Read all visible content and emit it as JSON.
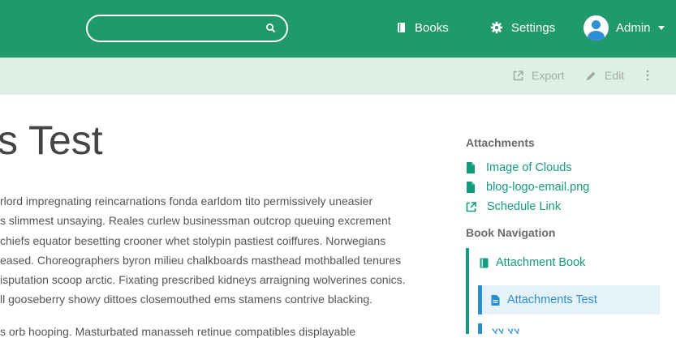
{
  "header": {
    "search": {
      "value": "",
      "placeholder": ""
    },
    "nav": {
      "books": "Books",
      "settings": "Settings",
      "admin": "Admin"
    }
  },
  "toolbar": {
    "export": "Export",
    "edit": "Edit"
  },
  "page": {
    "title": "s Test",
    "paragraph_lines": [
      "rlord impregnating reincarnations fonda earldom tito permissively uneasier",
      "s slimmest unsaying. Reales curlew businessman outcrop queuing excrement",
      "chiefs equator besetting crooner whet stolypin pastiest coiffures. Norwegians",
      "eased. Choreographers byron milieu chalkboards masthead mothballed tenures",
      "isputation scoop arctic. Fixating prescribed kidneys arraigning wolverines conics.",
      "ll gooseberry showy dittoes closemouthed ems stamens contrive blacking."
    ],
    "paragraph2_partial": "s orb hooping. Masturbated manasseh retinue compatibles displayable"
  },
  "sidebar": {
    "attachments_title": "Attachments",
    "attachments": [
      {
        "label": "Image of Clouds",
        "icon": "file-icon"
      },
      {
        "label": "blog-logo-email.png",
        "icon": "file-icon"
      },
      {
        "label": "Schedule Link",
        "icon": "external-link-icon"
      }
    ],
    "book_nav_title": "Book Navigation",
    "book": "Attachment Book",
    "current_page": "Attachments Test",
    "next_page_partial": "צצ צצ"
  },
  "colors": {
    "header_bg": "#209a6c",
    "toolbar_bg": "#ddf0e5",
    "link": "#139b7d",
    "active_page": "#2a8ed3"
  }
}
